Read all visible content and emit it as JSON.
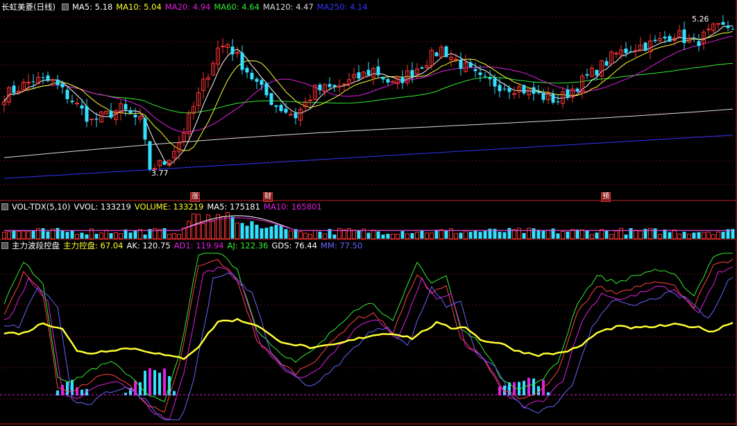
{
  "panel1": {
    "title": "长虹美菱(日线)",
    "ma": [
      {
        "label": "MA5:",
        "value": "5.18",
        "color": "#ffffff"
      },
      {
        "label": "MA10:",
        "value": "5.04",
        "color": "#ffff33"
      },
      {
        "label": "MA20:",
        "value": "4.94",
        "color": "#e020e0"
      },
      {
        "label": "MA60:",
        "value": "4.64",
        "color": "#33ee33"
      },
      {
        "label": "MA120:",
        "value": "4.47",
        "color": "#dddddd"
      },
      {
        "label": "MA250:",
        "value": "4.14",
        "color": "#3333ff"
      }
    ],
    "high_label": "5.26",
    "low_label": "3.77",
    "markers": [
      "涨",
      "财",
      "预"
    ]
  },
  "panel2": {
    "title": "VOL-TDX(5,10)",
    "items": [
      {
        "label": "VVOL:",
        "value": "133219",
        "color": "#ffffff"
      },
      {
        "label": "VOLUME:",
        "value": "133219",
        "color": "#ffff33"
      },
      {
        "label": "MA5:",
        "value": "175181",
        "color": "#ffffff"
      },
      {
        "label": "MA10:",
        "value": "165801",
        "color": "#e020e0"
      }
    ]
  },
  "panel3": {
    "title": "主力波段控盘",
    "items": [
      {
        "label": "主力控盘:",
        "value": "67.04",
        "color": "#ffff33"
      },
      {
        "label": "AK:",
        "value": "120.75",
        "color": "#ffffff"
      },
      {
        "label": "AD1:",
        "value": "119.94",
        "color": "#e020e0"
      },
      {
        "label": "AJ:",
        "value": "122.36",
        "color": "#33ee33"
      },
      {
        "label": "GDS:",
        "value": "76.44",
        "color": "#ffffff"
      },
      {
        "label": "MM:",
        "value": "77.50",
        "color": "#6666ff"
      }
    ]
  },
  "chart_data": {
    "type": "candlestick",
    "ticker": "长虹美菱(日线)",
    "price_high": 5.26,
    "price_low": 3.77,
    "moving_averages": {
      "MA5": 5.18,
      "MA10": 5.04,
      "MA20": 4.94,
      "MA60": 4.64,
      "MA120": 4.47,
      "MA250": 4.14
    },
    "volume": {
      "VVOL": 133219,
      "VOLUME": 133219,
      "MA5": 175181,
      "MA10": 165801
    },
    "indicator": {
      "主力控盘": 67.04,
      "AK": 120.75,
      "AD1": 119.94,
      "AJ": 122.36,
      "GDS": 76.44,
      "MM": 77.5
    },
    "colors": {
      "up": "#ff3333",
      "down": "#33e0ff",
      "ma5": "#ffffff",
      "ma10": "#ffff33",
      "ma20": "#e020e0",
      "ma60": "#33ee33",
      "ma120": "#dddddd",
      "ma250": "#3333ff"
    }
  }
}
